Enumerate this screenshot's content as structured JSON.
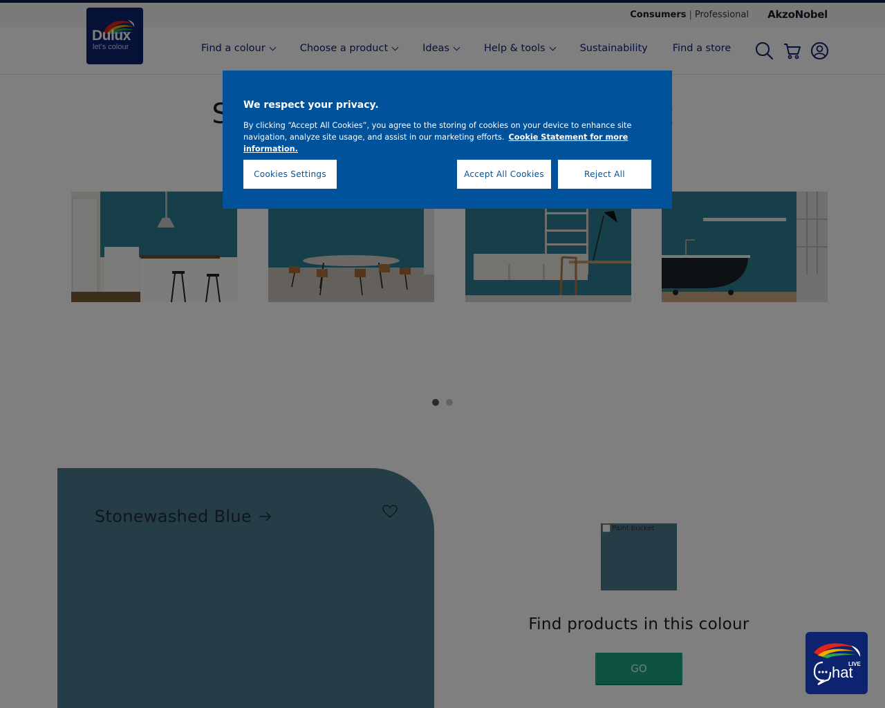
{
  "header": {
    "utility_links": [
      "Consumers",
      "Professional"
    ],
    "utility_separator": "|",
    "parent_brand": "AkzoNobel",
    "logo": {
      "word": "Dulux",
      "tagline": "let's colour"
    },
    "nav": [
      {
        "label": "Find a colour",
        "dropdown": true
      },
      {
        "label": "Choose a product",
        "dropdown": true
      },
      {
        "label": "Ideas",
        "dropdown": true
      },
      {
        "label": "Help & tools",
        "dropdown": true
      },
      {
        "label": "Sustainability",
        "dropdown": false
      },
      {
        "label": "Find a store",
        "dropdown": false
      }
    ],
    "icons": [
      "search-icon",
      "cart-icon",
      "account-icon"
    ]
  },
  "page": {
    "title_left": "Se",
    "title_right": "et",
    "carousel": {
      "slides": [
        "kitchen",
        "dining-room",
        "study",
        "bathroom"
      ],
      "dots": 2,
      "active_dot": 0
    },
    "colour_card": {
      "name": "Stonewashed Blue",
      "color": "#4a7a8f"
    },
    "products": {
      "image_alt": "Paint bucket",
      "text": "Find products in this colour",
      "button": "GO"
    }
  },
  "cookie_banner": {
    "title": "We respect your privacy.",
    "text": "By clicking “Accept All Cookies”, you agree to the storing of cookies on your device to enhance site navigation, analyze site usage, and assist in our marketing efforts.",
    "link": "Cookie Statement for more information.",
    "settings_button": "Cookies Settings",
    "accept_button": "Accept All Cookies",
    "reject_button": "Reject All",
    "background": "#00529b"
  },
  "colors": {
    "brand_navy": "#0c2370",
    "go_green": "#1da584",
    "teal_wall": "#2f7f92"
  }
}
